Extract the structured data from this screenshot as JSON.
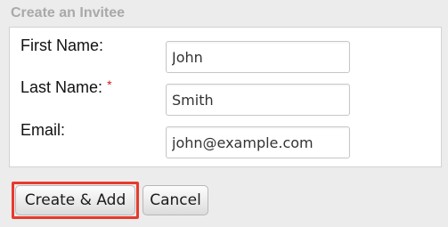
{
  "panel": {
    "title": "Create an Invitee"
  },
  "form": {
    "first_name": {
      "label": "First Name:",
      "value": "John"
    },
    "last_name": {
      "label": "Last Name:",
      "required_marker": "*",
      "value": "Smith"
    },
    "email": {
      "label": "Email:",
      "value": "john@example.com"
    }
  },
  "actions": {
    "create_add_label": "Create & Add",
    "cancel_label": "Cancel"
  },
  "colors": {
    "highlight": "#e8392d",
    "required": "#d01c1c"
  }
}
